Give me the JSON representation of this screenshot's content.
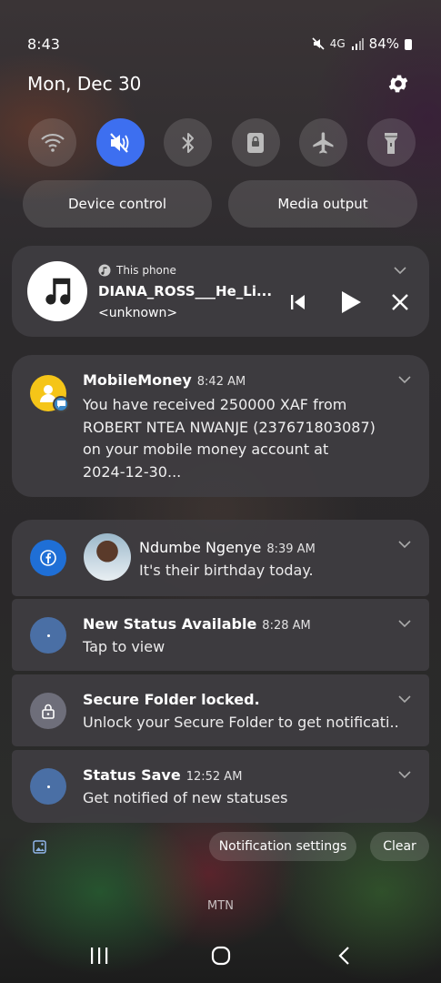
{
  "status_bar": {
    "time": "8:43",
    "network": "4G",
    "battery": "84%"
  },
  "header": {
    "date": "Mon, Dec 30"
  },
  "quick_settings": {
    "tiles": [
      {
        "name": "wifi-icon",
        "active": false
      },
      {
        "name": "sound-mute-icon",
        "active": true
      },
      {
        "name": "bluetooth-icon",
        "active": false
      },
      {
        "name": "rotation-lock-icon",
        "active": false
      },
      {
        "name": "airplane-icon",
        "active": false
      },
      {
        "name": "flashlight-icon",
        "active": false
      }
    ],
    "device_control": "Device control",
    "media_output": "Media output"
  },
  "media": {
    "source": "This phone",
    "title": "DIANA_ROSS___He_Li...",
    "artist": "<unknown>"
  },
  "notifications": {
    "mobile_money": {
      "app": "MobileMoney",
      "time": "8:42 AM",
      "line1": "You have received 250000 XAF from",
      "line2": "ROBERT NTEA NWANJE (237671803087)",
      "line3": "on your mobile money account at",
      "line4": "2024-12-30..."
    },
    "facebook": {
      "name": "Ndumbe Ngenye",
      "time": "8:39 AM",
      "text": "It's their birthday today."
    },
    "new_status": {
      "title": "New Status Available",
      "time": "8:28 AM",
      "text": "Tap to view"
    },
    "secure_folder": {
      "title": "Secure Folder locked.",
      "text": "Unlock your Secure Folder to get notificati.."
    },
    "status_save": {
      "title": "Status Save",
      "time": "12:52 AM",
      "text": "Get notified of new statuses"
    }
  },
  "footer": {
    "notification_settings": "Notification settings",
    "clear": "Clear",
    "carrier": "MTN"
  },
  "colors": {
    "accent": "#3d6ff0",
    "mobile_money_yellow": "#f5c518",
    "app_blue": "#4a6fa5"
  }
}
